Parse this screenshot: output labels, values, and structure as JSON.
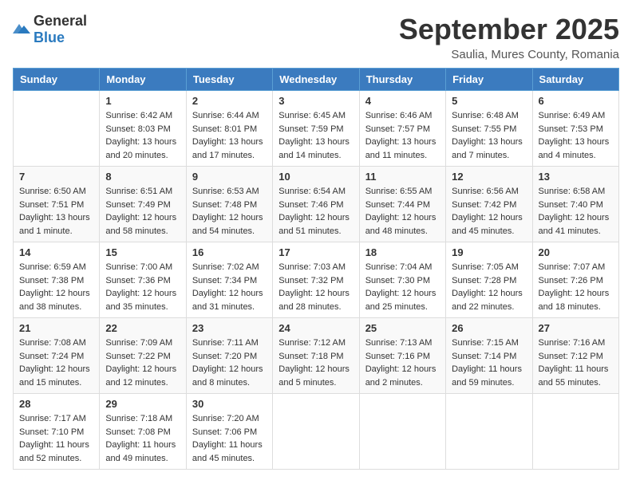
{
  "header": {
    "logo": {
      "general": "General",
      "blue": "Blue"
    },
    "month": "September 2025",
    "location": "Saulia, Mures County, Romania"
  },
  "days_of_week": [
    "Sunday",
    "Monday",
    "Tuesday",
    "Wednesday",
    "Thursday",
    "Friday",
    "Saturday"
  ],
  "weeks": [
    [
      {
        "day": "",
        "sunrise": "",
        "sunset": "",
        "daylight": ""
      },
      {
        "day": "1",
        "sunrise": "Sunrise: 6:42 AM",
        "sunset": "Sunset: 8:03 PM",
        "daylight": "Daylight: 13 hours and 20 minutes."
      },
      {
        "day": "2",
        "sunrise": "Sunrise: 6:44 AM",
        "sunset": "Sunset: 8:01 PM",
        "daylight": "Daylight: 13 hours and 17 minutes."
      },
      {
        "day": "3",
        "sunrise": "Sunrise: 6:45 AM",
        "sunset": "Sunset: 7:59 PM",
        "daylight": "Daylight: 13 hours and 14 minutes."
      },
      {
        "day": "4",
        "sunrise": "Sunrise: 6:46 AM",
        "sunset": "Sunset: 7:57 PM",
        "daylight": "Daylight: 13 hours and 11 minutes."
      },
      {
        "day": "5",
        "sunrise": "Sunrise: 6:48 AM",
        "sunset": "Sunset: 7:55 PM",
        "daylight": "Daylight: 13 hours and 7 minutes."
      },
      {
        "day": "6",
        "sunrise": "Sunrise: 6:49 AM",
        "sunset": "Sunset: 7:53 PM",
        "daylight": "Daylight: 13 hours and 4 minutes."
      }
    ],
    [
      {
        "day": "7",
        "sunrise": "Sunrise: 6:50 AM",
        "sunset": "Sunset: 7:51 PM",
        "daylight": "Daylight: 13 hours and 1 minute."
      },
      {
        "day": "8",
        "sunrise": "Sunrise: 6:51 AM",
        "sunset": "Sunset: 7:49 PM",
        "daylight": "Daylight: 12 hours and 58 minutes."
      },
      {
        "day": "9",
        "sunrise": "Sunrise: 6:53 AM",
        "sunset": "Sunset: 7:48 PM",
        "daylight": "Daylight: 12 hours and 54 minutes."
      },
      {
        "day": "10",
        "sunrise": "Sunrise: 6:54 AM",
        "sunset": "Sunset: 7:46 PM",
        "daylight": "Daylight: 12 hours and 51 minutes."
      },
      {
        "day": "11",
        "sunrise": "Sunrise: 6:55 AM",
        "sunset": "Sunset: 7:44 PM",
        "daylight": "Daylight: 12 hours and 48 minutes."
      },
      {
        "day": "12",
        "sunrise": "Sunrise: 6:56 AM",
        "sunset": "Sunset: 7:42 PM",
        "daylight": "Daylight: 12 hours and 45 minutes."
      },
      {
        "day": "13",
        "sunrise": "Sunrise: 6:58 AM",
        "sunset": "Sunset: 7:40 PM",
        "daylight": "Daylight: 12 hours and 41 minutes."
      }
    ],
    [
      {
        "day": "14",
        "sunrise": "Sunrise: 6:59 AM",
        "sunset": "Sunset: 7:38 PM",
        "daylight": "Daylight: 12 hours and 38 minutes."
      },
      {
        "day": "15",
        "sunrise": "Sunrise: 7:00 AM",
        "sunset": "Sunset: 7:36 PM",
        "daylight": "Daylight: 12 hours and 35 minutes."
      },
      {
        "day": "16",
        "sunrise": "Sunrise: 7:02 AM",
        "sunset": "Sunset: 7:34 PM",
        "daylight": "Daylight: 12 hours and 31 minutes."
      },
      {
        "day": "17",
        "sunrise": "Sunrise: 7:03 AM",
        "sunset": "Sunset: 7:32 PM",
        "daylight": "Daylight: 12 hours and 28 minutes."
      },
      {
        "day": "18",
        "sunrise": "Sunrise: 7:04 AM",
        "sunset": "Sunset: 7:30 PM",
        "daylight": "Daylight: 12 hours and 25 minutes."
      },
      {
        "day": "19",
        "sunrise": "Sunrise: 7:05 AM",
        "sunset": "Sunset: 7:28 PM",
        "daylight": "Daylight: 12 hours and 22 minutes."
      },
      {
        "day": "20",
        "sunrise": "Sunrise: 7:07 AM",
        "sunset": "Sunset: 7:26 PM",
        "daylight": "Daylight: 12 hours and 18 minutes."
      }
    ],
    [
      {
        "day": "21",
        "sunrise": "Sunrise: 7:08 AM",
        "sunset": "Sunset: 7:24 PM",
        "daylight": "Daylight: 12 hours and 15 minutes."
      },
      {
        "day": "22",
        "sunrise": "Sunrise: 7:09 AM",
        "sunset": "Sunset: 7:22 PM",
        "daylight": "Daylight: 12 hours and 12 minutes."
      },
      {
        "day": "23",
        "sunrise": "Sunrise: 7:11 AM",
        "sunset": "Sunset: 7:20 PM",
        "daylight": "Daylight: 12 hours and 8 minutes."
      },
      {
        "day": "24",
        "sunrise": "Sunrise: 7:12 AM",
        "sunset": "Sunset: 7:18 PM",
        "daylight": "Daylight: 12 hours and 5 minutes."
      },
      {
        "day": "25",
        "sunrise": "Sunrise: 7:13 AM",
        "sunset": "Sunset: 7:16 PM",
        "daylight": "Daylight: 12 hours and 2 minutes."
      },
      {
        "day": "26",
        "sunrise": "Sunrise: 7:15 AM",
        "sunset": "Sunset: 7:14 PM",
        "daylight": "Daylight: 11 hours and 59 minutes."
      },
      {
        "day": "27",
        "sunrise": "Sunrise: 7:16 AM",
        "sunset": "Sunset: 7:12 PM",
        "daylight": "Daylight: 11 hours and 55 minutes."
      }
    ],
    [
      {
        "day": "28",
        "sunrise": "Sunrise: 7:17 AM",
        "sunset": "Sunset: 7:10 PM",
        "daylight": "Daylight: 11 hours and 52 minutes."
      },
      {
        "day": "29",
        "sunrise": "Sunrise: 7:18 AM",
        "sunset": "Sunset: 7:08 PM",
        "daylight": "Daylight: 11 hours and 49 minutes."
      },
      {
        "day": "30",
        "sunrise": "Sunrise: 7:20 AM",
        "sunset": "Sunset: 7:06 PM",
        "daylight": "Daylight: 11 hours and 45 minutes."
      },
      {
        "day": "",
        "sunrise": "",
        "sunset": "",
        "daylight": ""
      },
      {
        "day": "",
        "sunrise": "",
        "sunset": "",
        "daylight": ""
      },
      {
        "day": "",
        "sunrise": "",
        "sunset": "",
        "daylight": ""
      },
      {
        "day": "",
        "sunrise": "",
        "sunset": "",
        "daylight": ""
      }
    ]
  ]
}
